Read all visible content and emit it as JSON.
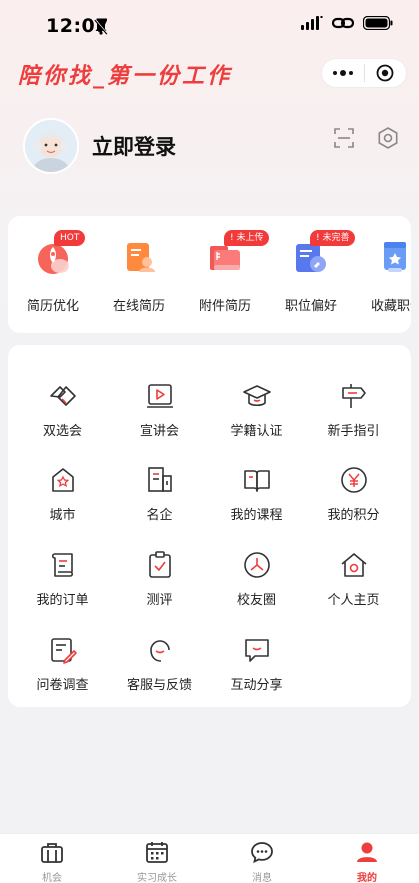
{
  "status": {
    "time": "12:07"
  },
  "header": {
    "brand": "陪你找_第一份工作"
  },
  "profile": {
    "login_label": "立即登录"
  },
  "quick_actions": [
    {
      "label": "简历优化",
      "badge": "HOT",
      "icon": "rocket-resume-icon"
    },
    {
      "label": "在线简历",
      "badge": "",
      "icon": "online-resume-icon"
    },
    {
      "label": "附件简历",
      "badge": "! 未上传",
      "icon": "attachment-folder-icon"
    },
    {
      "label": "职位偏好",
      "badge": "! 未完善",
      "icon": "preference-card-icon"
    },
    {
      "label": "收藏职位",
      "badge": "",
      "icon": "bookmark-star-icon"
    }
  ],
  "services": [
    {
      "label": "双选会",
      "icon": "handshake-icon"
    },
    {
      "label": "宣讲会",
      "icon": "presentation-play-icon"
    },
    {
      "label": "学籍认证",
      "icon": "graduation-cap-icon"
    },
    {
      "label": "新手指引",
      "icon": "signpost-icon"
    },
    {
      "label": "城市",
      "icon": "city-home-icon"
    },
    {
      "label": "名企",
      "icon": "building-icon"
    },
    {
      "label": "我的课程",
      "icon": "open-book-icon"
    },
    {
      "label": "我的积分",
      "icon": "yen-coin-icon"
    },
    {
      "label": "我的订单",
      "icon": "order-scroll-icon"
    },
    {
      "label": "测评",
      "icon": "clipboard-check-icon"
    },
    {
      "label": "校友圈",
      "icon": "alumni-circle-icon"
    },
    {
      "label": "个人主页",
      "icon": "personal-home-icon"
    },
    {
      "label": "问卷调查",
      "icon": "survey-pen-icon"
    },
    {
      "label": "客服与反馈",
      "icon": "service-smile-icon"
    },
    {
      "label": "互动分享",
      "icon": "chat-bubble-icon"
    }
  ],
  "tabs": [
    {
      "label": "机会",
      "icon": "briefcase-icon",
      "active": false
    },
    {
      "label": "实习成长",
      "icon": "calendar-icon",
      "active": false
    },
    {
      "label": "消息",
      "icon": "message-icon",
      "active": false
    },
    {
      "label": "我的",
      "icon": "person-icon",
      "active": true
    }
  ],
  "colors": {
    "accent": "#ee3d3d",
    "badge": "#f23a3a",
    "icon_stroke": "#333333"
  }
}
